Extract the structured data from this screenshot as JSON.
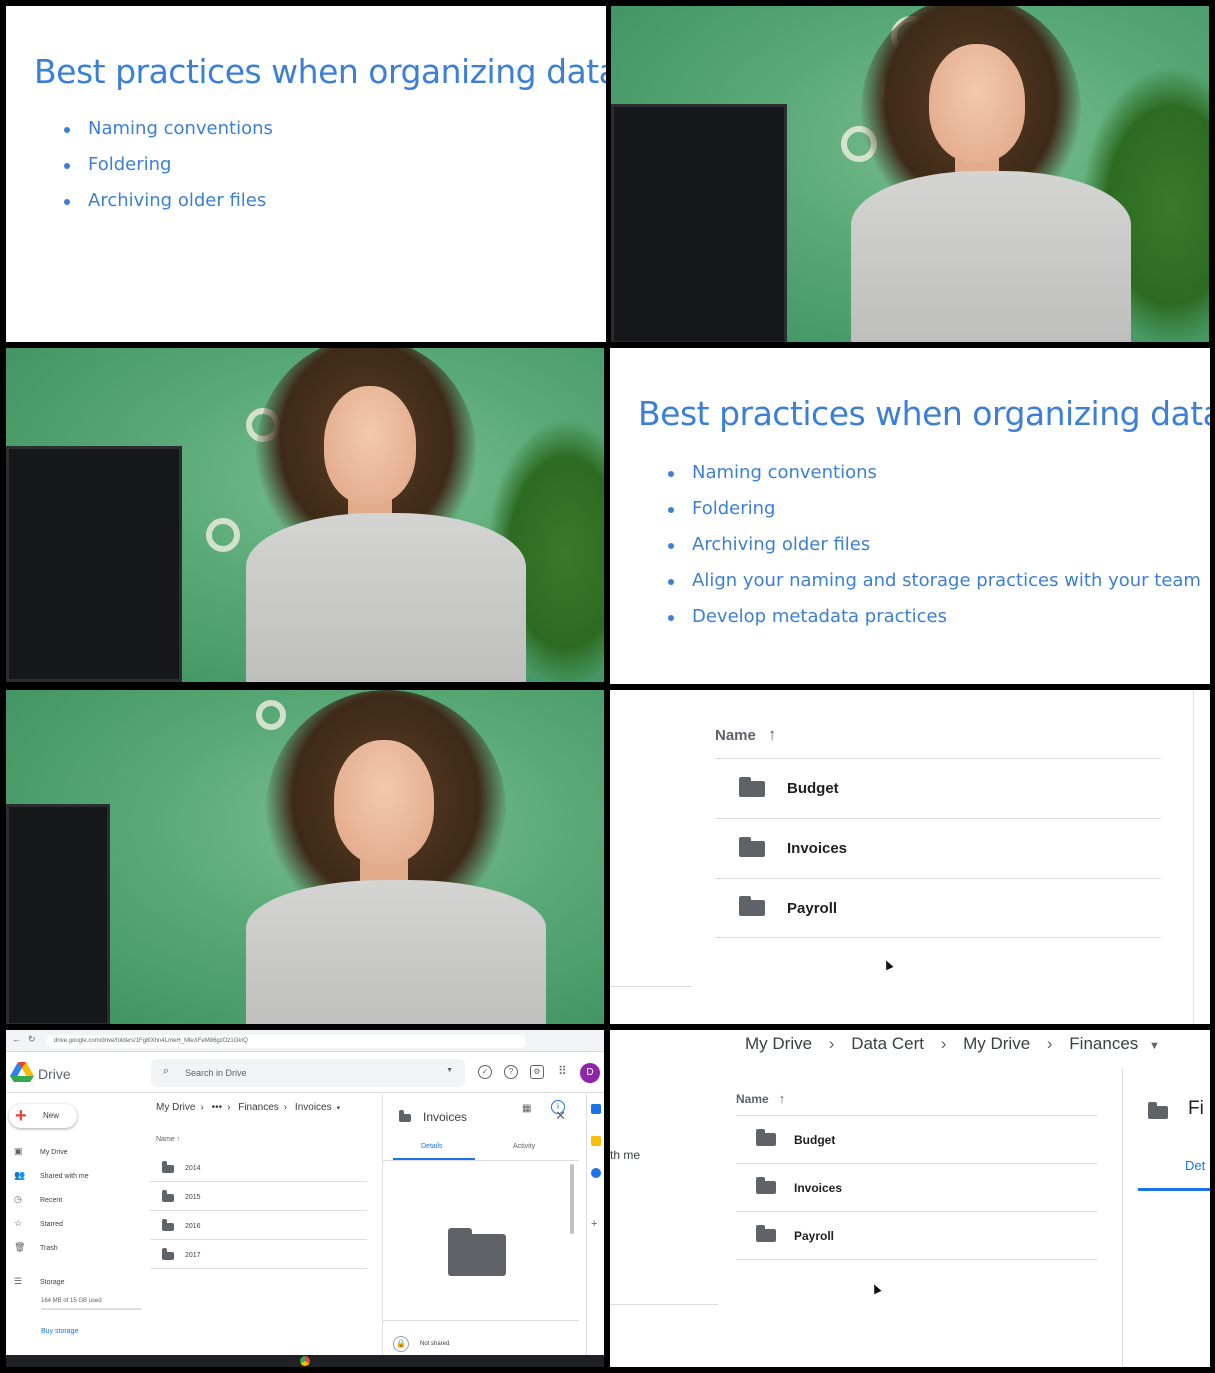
{
  "slides": {
    "title": "Best practices when organizing data",
    "bullets_short": [
      "Naming conventions",
      "Foldering",
      "Archiving older files"
    ],
    "bullets_long": [
      "Naming conventions",
      "Foldering",
      "Archiving older files",
      "Align your naming and storage practices with your team",
      "Develop metadata practices"
    ]
  },
  "zoom_list": {
    "header": "Name",
    "sort_icon": "arrow-up-icon",
    "folders": [
      "Budget",
      "Invoices",
      "Payroll"
    ]
  },
  "zoom_crumbs": {
    "items": [
      "My Drive",
      "Data Cert",
      "My Drive",
      "Finances"
    ],
    "side_text": "th me",
    "panel_tab_partial": "Det",
    "panel_title_partial": "Fi"
  },
  "drive": {
    "url": "drive.google.com/drive/folders/1Fg8lXhn4LmeH_MleXFeM86gzOz1GkIQ",
    "app_name": "Drive",
    "search_placeholder": "Search in Drive",
    "avatar_letter": "D",
    "new_label": "New",
    "nav": [
      "My Drive",
      "Shared with me",
      "Recent",
      "Starred",
      "Trash"
    ],
    "storage_label": "Storage",
    "storage_used": "164 MB of 15 GB used",
    "buy_storage": "Buy storage",
    "breadcrumb": [
      "My Drive",
      "•••",
      "Finances",
      "Invoices"
    ],
    "column_name": "Name",
    "folders": [
      "2014",
      "2015",
      "2016",
      "2017"
    ],
    "details_title": "Invoices",
    "tab_details": "Details",
    "tab_activity": "Activity",
    "sharing": "Not shared",
    "accent_color": "#1a73e8"
  }
}
